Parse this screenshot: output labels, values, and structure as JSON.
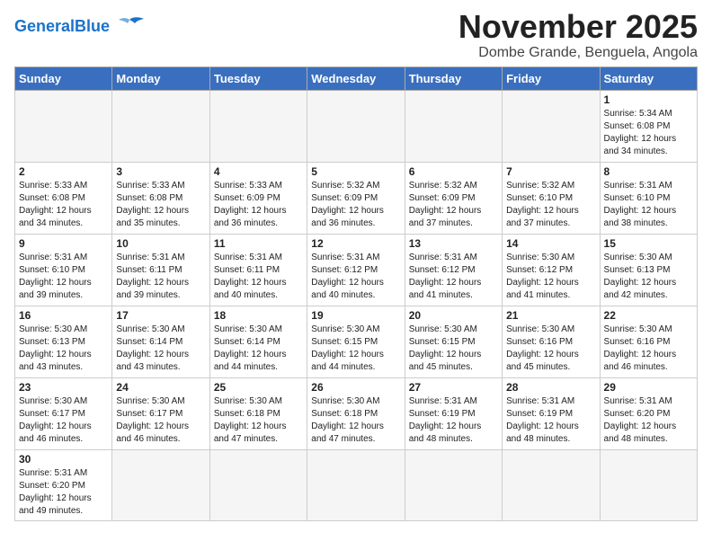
{
  "logo": {
    "general": "General",
    "blue": "Blue"
  },
  "title": "November 2025",
  "subtitle": "Dombe Grande, Benguela, Angola",
  "weekdays": [
    "Sunday",
    "Monday",
    "Tuesday",
    "Wednesday",
    "Thursday",
    "Friday",
    "Saturday"
  ],
  "weeks": [
    [
      {
        "day": "",
        "info": ""
      },
      {
        "day": "",
        "info": ""
      },
      {
        "day": "",
        "info": ""
      },
      {
        "day": "",
        "info": ""
      },
      {
        "day": "",
        "info": ""
      },
      {
        "day": "",
        "info": ""
      },
      {
        "day": "1",
        "info": "Sunrise: 5:34 AM\nSunset: 6:08 PM\nDaylight: 12 hours\nand 34 minutes."
      }
    ],
    [
      {
        "day": "2",
        "info": "Sunrise: 5:33 AM\nSunset: 6:08 PM\nDaylight: 12 hours\nand 34 minutes."
      },
      {
        "day": "3",
        "info": "Sunrise: 5:33 AM\nSunset: 6:08 PM\nDaylight: 12 hours\nand 35 minutes."
      },
      {
        "day": "4",
        "info": "Sunrise: 5:33 AM\nSunset: 6:09 PM\nDaylight: 12 hours\nand 36 minutes."
      },
      {
        "day": "5",
        "info": "Sunrise: 5:32 AM\nSunset: 6:09 PM\nDaylight: 12 hours\nand 36 minutes."
      },
      {
        "day": "6",
        "info": "Sunrise: 5:32 AM\nSunset: 6:09 PM\nDaylight: 12 hours\nand 37 minutes."
      },
      {
        "day": "7",
        "info": "Sunrise: 5:32 AM\nSunset: 6:10 PM\nDaylight: 12 hours\nand 37 minutes."
      },
      {
        "day": "8",
        "info": "Sunrise: 5:31 AM\nSunset: 6:10 PM\nDaylight: 12 hours\nand 38 minutes."
      }
    ],
    [
      {
        "day": "9",
        "info": "Sunrise: 5:31 AM\nSunset: 6:10 PM\nDaylight: 12 hours\nand 39 minutes."
      },
      {
        "day": "10",
        "info": "Sunrise: 5:31 AM\nSunset: 6:11 PM\nDaylight: 12 hours\nand 39 minutes."
      },
      {
        "day": "11",
        "info": "Sunrise: 5:31 AM\nSunset: 6:11 PM\nDaylight: 12 hours\nand 40 minutes."
      },
      {
        "day": "12",
        "info": "Sunrise: 5:31 AM\nSunset: 6:12 PM\nDaylight: 12 hours\nand 40 minutes."
      },
      {
        "day": "13",
        "info": "Sunrise: 5:31 AM\nSunset: 6:12 PM\nDaylight: 12 hours\nand 41 minutes."
      },
      {
        "day": "14",
        "info": "Sunrise: 5:30 AM\nSunset: 6:12 PM\nDaylight: 12 hours\nand 41 minutes."
      },
      {
        "day": "15",
        "info": "Sunrise: 5:30 AM\nSunset: 6:13 PM\nDaylight: 12 hours\nand 42 minutes."
      }
    ],
    [
      {
        "day": "16",
        "info": "Sunrise: 5:30 AM\nSunset: 6:13 PM\nDaylight: 12 hours\nand 43 minutes."
      },
      {
        "day": "17",
        "info": "Sunrise: 5:30 AM\nSunset: 6:14 PM\nDaylight: 12 hours\nand 43 minutes."
      },
      {
        "day": "18",
        "info": "Sunrise: 5:30 AM\nSunset: 6:14 PM\nDaylight: 12 hours\nand 44 minutes."
      },
      {
        "day": "19",
        "info": "Sunrise: 5:30 AM\nSunset: 6:15 PM\nDaylight: 12 hours\nand 44 minutes."
      },
      {
        "day": "20",
        "info": "Sunrise: 5:30 AM\nSunset: 6:15 PM\nDaylight: 12 hours\nand 45 minutes."
      },
      {
        "day": "21",
        "info": "Sunrise: 5:30 AM\nSunset: 6:16 PM\nDaylight: 12 hours\nand 45 minutes."
      },
      {
        "day": "22",
        "info": "Sunrise: 5:30 AM\nSunset: 6:16 PM\nDaylight: 12 hours\nand 46 minutes."
      }
    ],
    [
      {
        "day": "23",
        "info": "Sunrise: 5:30 AM\nSunset: 6:17 PM\nDaylight: 12 hours\nand 46 minutes."
      },
      {
        "day": "24",
        "info": "Sunrise: 5:30 AM\nSunset: 6:17 PM\nDaylight: 12 hours\nand 46 minutes."
      },
      {
        "day": "25",
        "info": "Sunrise: 5:30 AM\nSunset: 6:18 PM\nDaylight: 12 hours\nand 47 minutes."
      },
      {
        "day": "26",
        "info": "Sunrise: 5:30 AM\nSunset: 6:18 PM\nDaylight: 12 hours\nand 47 minutes."
      },
      {
        "day": "27",
        "info": "Sunrise: 5:31 AM\nSunset: 6:19 PM\nDaylight: 12 hours\nand 48 minutes."
      },
      {
        "day": "28",
        "info": "Sunrise: 5:31 AM\nSunset: 6:19 PM\nDaylight: 12 hours\nand 48 minutes."
      },
      {
        "day": "29",
        "info": "Sunrise: 5:31 AM\nSunset: 6:20 PM\nDaylight: 12 hours\nand 48 minutes."
      }
    ],
    [
      {
        "day": "30",
        "info": "Sunrise: 5:31 AM\nSunset: 6:20 PM\nDaylight: 12 hours\nand 49 minutes."
      },
      {
        "day": "",
        "info": ""
      },
      {
        "day": "",
        "info": ""
      },
      {
        "day": "",
        "info": ""
      },
      {
        "day": "",
        "info": ""
      },
      {
        "day": "",
        "info": ""
      },
      {
        "day": "",
        "info": ""
      }
    ]
  ]
}
